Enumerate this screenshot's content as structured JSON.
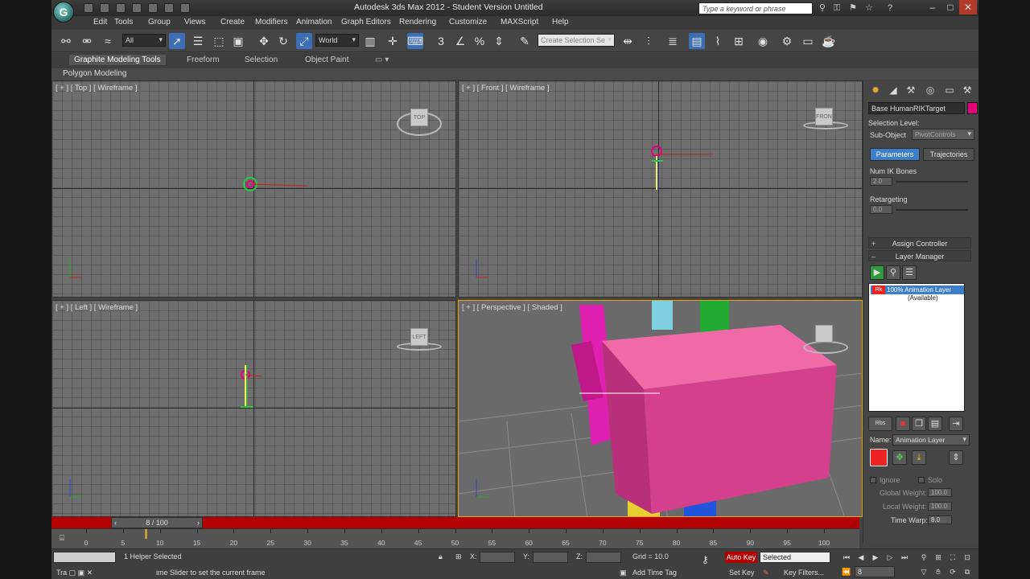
{
  "window": {
    "title": "Autodesk 3ds Max 2012 - Student Version    Untitled",
    "search_placeholder": "Type a keyword or phrase",
    "logo": "G"
  },
  "menu": [
    "Edit",
    "Tools",
    "Group",
    "Views",
    "Create",
    "Modifiers",
    "Animation",
    "Graph Editors",
    "Rendering",
    "Customize",
    "MAXScript",
    "Help"
  ],
  "toolbar": {
    "selection_filter": "All",
    "ref_coord": "World",
    "named_selection_placeholder": "Create Selection Se"
  },
  "ribbon": {
    "tabs": [
      "Graphite Modeling Tools",
      "Freeform",
      "Selection",
      "Object Paint"
    ],
    "panel": "Polygon Modeling"
  },
  "viewports": {
    "top": "[ + ] [ Top ] [ Wireframe ]",
    "front": "[ + ] [ Front ] [ Wireframe ]",
    "left": "[ + ] [ Left ] [ Wireframe ]",
    "perspective": "[ + ] [ Perspective ] [ Shaded ]",
    "cube_top": "TOP",
    "cube_front": "FRONT",
    "cube_left": "LEFT"
  },
  "command_panel": {
    "object_name": "Base HumanRIKTarget",
    "object_color": "#e6007a",
    "selection_level_label": "Selection Level:",
    "sub_object_label": "Sub-Object",
    "sub_object_value": "PivotControls",
    "tab_parameters": "Parameters",
    "tab_trajectories": "Trajectories",
    "num_ik_bones_label": "Num IK Bones",
    "num_ik_bones_value": "2.0",
    "retargeting_label": "Retargeting",
    "retargeting_value": "0.0",
    "assign_controller": "Assign Controller",
    "layer_manager": "Layer Manager",
    "layer_row": "100% Animation Layer",
    "layer_row_sub": "(Available)",
    "layer_row_icon": "Rk",
    "name_label": "Name:",
    "name_value": "Animation Layer",
    "ignore_label": "Ignore",
    "solo_label": "Solo",
    "global_weight_label": "Global Weight:",
    "global_weight_value": "100.0",
    "local_weight_label": "Local Weight:",
    "local_weight_value": "100.0",
    "time_warp_label": "Time Warp:",
    "time_warp_value": "8.0",
    "rbs_label": "Rbs"
  },
  "timeline": {
    "frame_display": "8 / 100",
    "current_frame": 8,
    "total_frames": 100,
    "ticks": [
      "0",
      "5",
      "10",
      "15",
      "20",
      "25",
      "30",
      "35",
      "40",
      "45",
      "50",
      "55",
      "60",
      "65",
      "70",
      "75",
      "80",
      "85",
      "90",
      "95",
      "100"
    ]
  },
  "status": {
    "selection_info": "1 Helper Selected",
    "prompt": "ime Slider to set the current frame",
    "x_label": "X:",
    "y_label": "Y:",
    "z_label": "Z:",
    "grid": "Grid = 10.0",
    "add_time_tag": "Add Time Tag",
    "auto_key": "Auto Key",
    "selected": "Selected",
    "set_key": "Set Key",
    "key_filters": "Key Filters...",
    "frame_field": "8",
    "taskbar_label": "Tra"
  },
  "colors": {
    "accent": "#3d7ec9",
    "timeline_red": "#b30000",
    "box_pink": "#e04c9a"
  }
}
